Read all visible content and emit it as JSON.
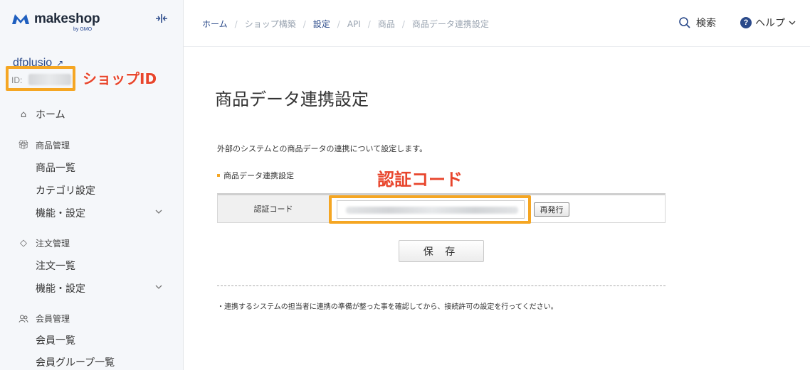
{
  "sidebar": {
    "brand": "makeshop",
    "brand_sub": "by GMO",
    "shop_name": "dfplusio",
    "shop_id_label": "ID:",
    "home": "ホーム",
    "sections": [
      {
        "title": "商品管理",
        "items": [
          "商品一覧",
          "カテゴリ設定",
          "機能・設定"
        ]
      },
      {
        "title": "注文管理",
        "items": [
          "注文一覧",
          "機能・設定"
        ]
      },
      {
        "title": "会員管理",
        "items": [
          "会員一覧",
          "会員グループ一覧"
        ]
      }
    ]
  },
  "annotations": {
    "shop_id": "ショップID",
    "auth_code": "認証コード"
  },
  "header": {
    "breadcrumb": [
      "ホーム",
      "ショップ構築",
      "設定",
      "API",
      "商品",
      "商品データ連携設定"
    ],
    "search_label": "検索",
    "help_label": "ヘルプ",
    "help_icon_glyph": "?"
  },
  "main": {
    "title": "商品データ連携設定",
    "description": "外部のシステムとの商品データの連携について設定します。",
    "section_label": "商品データ連携設定",
    "auth_code_label": "認証コード",
    "reissue_label": "再発行",
    "save_label": "保 存",
    "note": "・連携するシステムの担当者に連携の準備が整った事を確認してから、接続許可の設定を行ってください。"
  },
  "colors": {
    "accent": "#2b4a8a",
    "annotation": "#e8452c",
    "highlight": "#f5a623"
  }
}
